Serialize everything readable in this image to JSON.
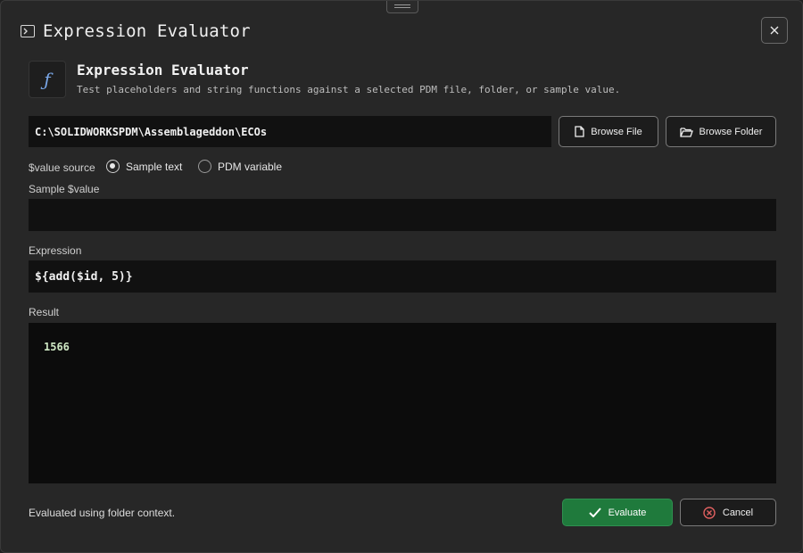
{
  "window": {
    "title": "Expression Evaluator"
  },
  "header": {
    "icon_glyph": "ƒ",
    "title": "Expression Evaluator",
    "subtitle": "Test placeholders and string functions against a selected PDM file, folder, or sample value."
  },
  "path": {
    "value": "C:\\SOLIDWORKSPDM\\Assemblageddon\\ECOs"
  },
  "buttons": {
    "browse_file": "Browse File",
    "browse_folder": "Browse Folder",
    "evaluate": "Evaluate",
    "cancel": "Cancel"
  },
  "value_source": {
    "label": "$value source",
    "options": [
      {
        "label": "Sample text",
        "checked": true
      },
      {
        "label": "PDM variable",
        "checked": false
      }
    ]
  },
  "sample": {
    "label": "Sample $value",
    "value": ""
  },
  "expression": {
    "label": "Expression",
    "value": "${add($id, 5)}"
  },
  "result": {
    "label": "Result",
    "value": "1566"
  },
  "status": {
    "text": "Evaluated using folder context."
  },
  "icons": [
    "terminal-icon",
    "close-icon",
    "function-icon",
    "file-icon",
    "folder-open-icon",
    "checkmark-icon",
    "cancel-circle-icon"
  ],
  "colors": {
    "accent_green": "#1f7a3c",
    "function_blue": "#7aa7e8",
    "cancel_red": "#e06060"
  }
}
